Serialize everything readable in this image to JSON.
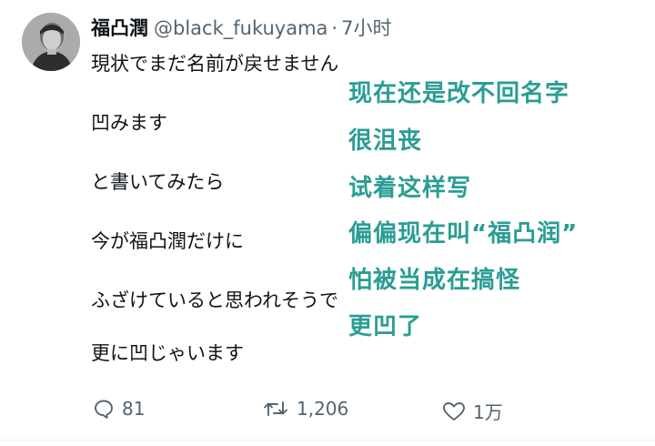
{
  "user": {
    "display_name": "福凸潤",
    "handle": "@black_fukuyama",
    "separator": "·",
    "time": "7小时"
  },
  "tweet_lines": [
    "現状でまだ名前が戻せません",
    "凹みます",
    "と書いてみたら",
    "今が福凸潤だけに",
    "ふざけていると思われそうで",
    "更に凹じゃいます"
  ],
  "translation_lines": [
    "现在还是改不回名字",
    "很沮丧",
    "试着这样写",
    "偏偏现在叫“福凸润”",
    "怕被当成在搞怪",
    "更凹了"
  ],
  "actions": {
    "reply_count": "81",
    "retweet_count": "1,206",
    "like_count": "1万"
  },
  "colors": {
    "text": "#0f1419",
    "secondary": "#536471",
    "translation": "#2a9d94"
  }
}
